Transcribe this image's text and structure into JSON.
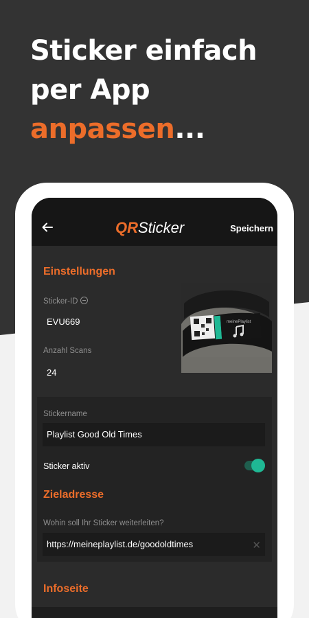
{
  "promo": {
    "line1": "Sticker einfach",
    "line2": "per App",
    "line3_accent": "anpassen",
    "line3_rest": "...",
    "accent_color": "#ec6d2a"
  },
  "appbar": {
    "back_icon": "arrow-left-icon",
    "logo_prefix": "QR",
    "logo_suffix": "Sticker",
    "save_label": "Speichern"
  },
  "settings": {
    "title": "Einstellungen",
    "sticker_id_label": "Sticker-ID",
    "sticker_id_value": "EVU669",
    "scans_label": "Anzahl Scans",
    "scans_value": "24",
    "photo_alt": "sticker-photo"
  },
  "sticker": {
    "name_label": "Stickername",
    "name_value": "Playlist Good Old Times",
    "active_label": "Sticker aktiv",
    "active": true
  },
  "target": {
    "title": "Zieladresse",
    "question_label": "Wohin soll Ihr Sticker weiterleiten?",
    "url_value": "https://meineplaylist.de/goodoldtimes",
    "clear_icon": "close-icon"
  },
  "info": {
    "title": "Infoseite"
  },
  "photo_sticker": {
    "brand": "meinePlaylist",
    "note_icon": "music-note-icon"
  }
}
